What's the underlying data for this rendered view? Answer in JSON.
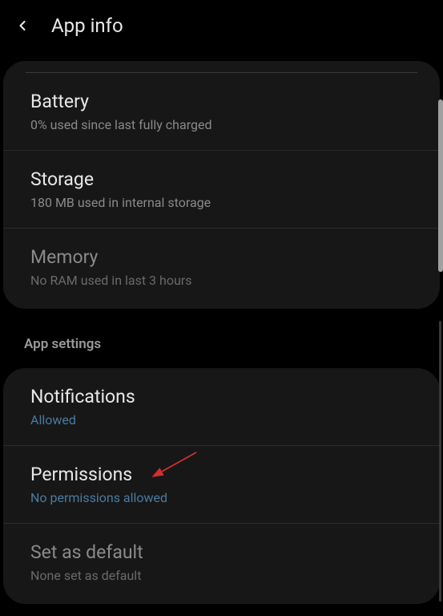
{
  "header": {
    "title": "App info"
  },
  "usage": {
    "battery": {
      "title": "Battery",
      "subtitle": "0% used since last fully charged"
    },
    "storage": {
      "title": "Storage",
      "subtitle": "180 MB used in internal storage"
    },
    "memory": {
      "title": "Memory",
      "subtitle": "No RAM used in last 3 hours"
    }
  },
  "settings_section": {
    "header": "App settings",
    "notifications": {
      "title": "Notifications",
      "subtitle": "Allowed"
    },
    "permissions": {
      "title": "Permissions",
      "subtitle": "No permissions allowed"
    },
    "set_default": {
      "title": "Set as default",
      "subtitle": "None set as default"
    }
  }
}
